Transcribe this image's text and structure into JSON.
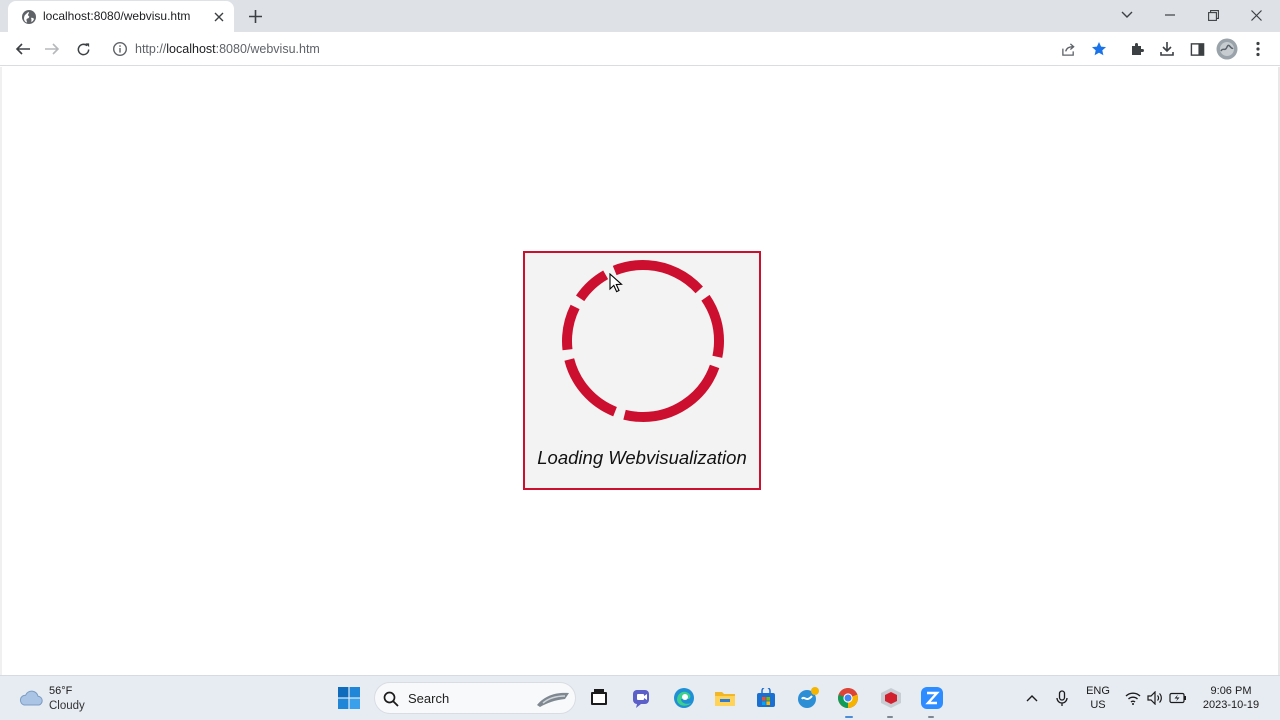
{
  "browser": {
    "tab_title": "localhost:8080/webvisu.htm",
    "url_prefix": "http://",
    "url_host": "localhost",
    "url_rest": ":8080/webvisu.htm"
  },
  "page": {
    "loading_text": "Loading Webvisualization",
    "accent_color": "#cc0f2f"
  },
  "taskbar": {
    "weather_temp": "56°F",
    "weather_condition": "Cloudy",
    "search_label": "Search",
    "language_top": "ENG",
    "language_bottom": "US",
    "time": "9:06 PM",
    "date": "2023-10-19"
  }
}
